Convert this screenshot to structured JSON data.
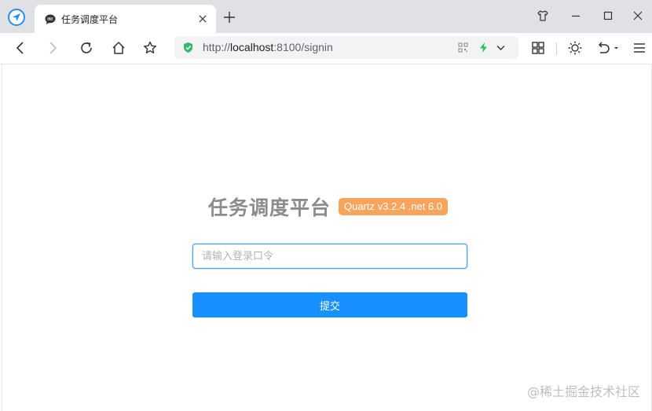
{
  "browser": {
    "tab": {
      "title": "任务调度平台"
    },
    "address_bar": {
      "scheme": "http://",
      "host": "localhost",
      "rest": ":8100/signin"
    }
  },
  "colors": {
    "accent": "#1890ff",
    "badge": "#f7a45c",
    "title": "#8c8c8c",
    "input_border": "#409eff"
  },
  "login": {
    "title": "任务调度平台",
    "version_badge": "Quartz v3.2.4 .net 6.0",
    "token_input": {
      "placeholder": "请输入登录口令",
      "value": ""
    },
    "submit_label": "提交"
  },
  "watermark": "@稀土掘金技术社区"
}
